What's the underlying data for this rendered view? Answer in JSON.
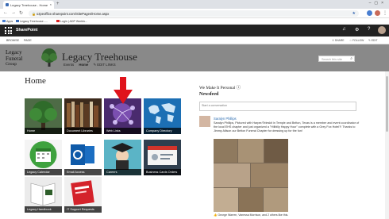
{
  "browser": {
    "tab_title": "Legacy Treehouse - Home",
    "url": "ozpeoffice.sharepoint.com/SitePages/Home.aspx",
    "bookmarks": [
      "Apps",
      "Legacy Treehouse -...",
      "Login | ADP Workfo..."
    ]
  },
  "suitebar": {
    "brand": "SharePoint"
  },
  "ribbon": {
    "left_items": [
      "BROWSE",
      "PAGE"
    ],
    "share": "SHARE",
    "follow": "FOLLOW",
    "edit": "EDIT"
  },
  "header": {
    "logo_line1": "Legacy",
    "logo_line2": "Funeral",
    "logo_line3": "Group",
    "site_title": "Legacy Treehouse",
    "nav": [
      "Events",
      "Home"
    ],
    "edit_links": "EDIT LINKS",
    "search_placeholder": "Search this site"
  },
  "page": {
    "title": "Home"
  },
  "tiles": [
    {
      "label": "Home"
    },
    {
      "label": "Document Libraries"
    },
    {
      "label": "Web Links"
    },
    {
      "label": "Company Directory"
    },
    {
      "label": "Legacy Calendar"
    },
    {
      "label": "Email Access"
    },
    {
      "label": "Careers"
    },
    {
      "label": "Business Cards Orders"
    },
    {
      "label": "Legacy Handbook"
    },
    {
      "label": "IT Support Requests"
    }
  ],
  "feed": {
    "heading": "We Make It Personal",
    "newsfeed": "Newsfeed",
    "compose_placeholder": "Start a conversation",
    "post_author": "Saralyn Phillips",
    "post_text": "Saralyn Phillips, Pictured with Harper/Teleskit in Temple and Belton, Texas is a member and event coordinator of the local EHS chapter and just organized a \"Hillbilly Happy Hour\" complete with a Grey Fox Hotel?! Thanks to Jimmy Allison our Belton Funeral Chapter for dressing up for the fun!",
    "likes_text": "George Warren, Vanessa Morrison, and 2 others like this."
  },
  "colors": {
    "suitebar": "#222222",
    "header": "#898989",
    "link": "#2b6cb0",
    "arrow": "#e0131b"
  }
}
